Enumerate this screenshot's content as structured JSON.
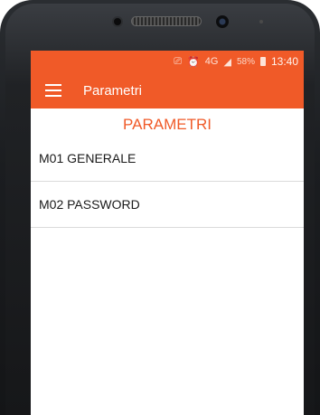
{
  "status_bar": {
    "icons": [
      "cast-icon",
      "alarm-icon",
      "4g-icon",
      "signal-icon"
    ],
    "network": "4G",
    "battery": "58%",
    "time": "13:40"
  },
  "app_bar": {
    "title": "Parametri"
  },
  "heading": "PARAMETRI",
  "menu": [
    {
      "label": "M01 GENERALE"
    },
    {
      "label": "M02 PASSWORD"
    }
  ],
  "colors": {
    "accent": "#f05a28"
  }
}
